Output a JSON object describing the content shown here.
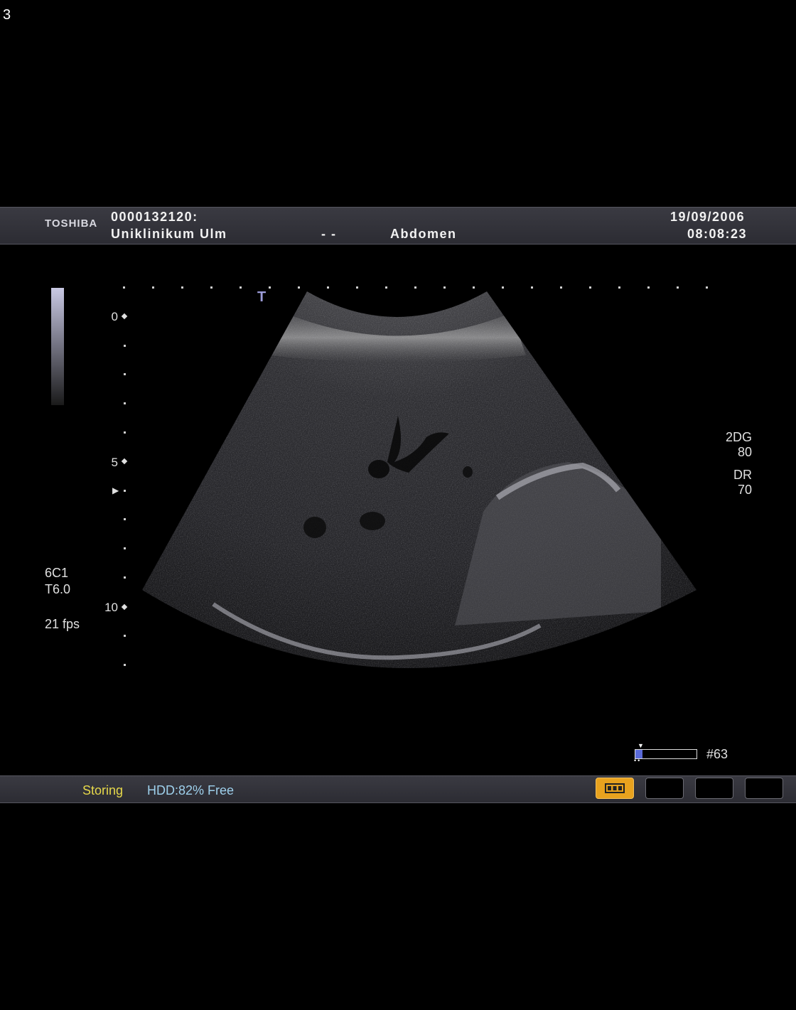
{
  "page_label": "3",
  "header": {
    "brand": "TOSHIBA",
    "patient_id": "0000132120:",
    "institution": "Uniklinikum Ulm",
    "separator": "- -",
    "exam": "Abdomen",
    "date": "19/09/2006",
    "time": "08:08:23"
  },
  "depth_scale": {
    "labels": [
      "0",
      "5",
      "10"
    ]
  },
  "transducer_marker": "T",
  "left_info": {
    "probe": "6C1",
    "frequency": "T6.0",
    "frame_rate": "21 fps"
  },
  "right_info": {
    "gain_label": "2DG",
    "gain_value": "80",
    "dr_label": "DR",
    "dr_value": "70"
  },
  "cine": {
    "frame": "#63",
    "progress": 0.12
  },
  "footer": {
    "status": "Storing",
    "disk": "HDD:82% Free"
  },
  "colors": {
    "status_text": "#e6d84a",
    "disk_text": "#9ed0ec",
    "active_button": "#e8a21e"
  },
  "icons": [
    "film-strip-icon"
  ]
}
